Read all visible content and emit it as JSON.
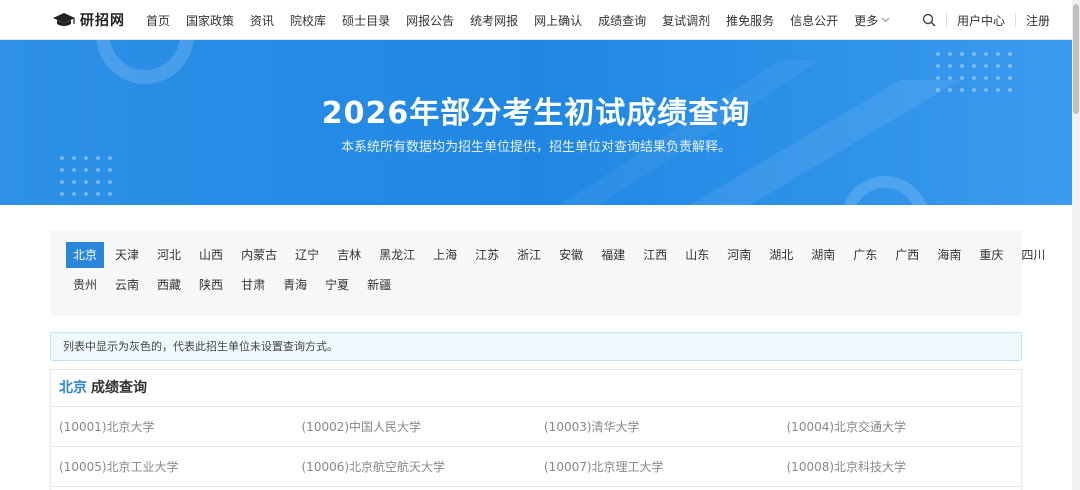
{
  "header": {
    "logo_text": "研招网",
    "nav": [
      "首页",
      "国家政策",
      "资讯",
      "院校库",
      "硕士目录",
      "网报公告",
      "统考网报",
      "网上确认",
      "成绩查询",
      "复试调剂",
      "推免服务",
      "信息公开"
    ],
    "more_label": "更多",
    "user_center": "用户中心",
    "register": "注册"
  },
  "banner": {
    "title": "2026年部分考生初试成绩查询",
    "subtitle": "本系统所有数据均为招生单位提供，招生单位对查询结果负责解释。"
  },
  "provinces": {
    "row1": [
      "北京",
      "天津",
      "河北",
      "山西",
      "内蒙古",
      "辽宁",
      "吉林",
      "黑龙江",
      "上海",
      "江苏",
      "浙江",
      "安徽",
      "福建",
      "江西",
      "山东",
      "河南",
      "湖北",
      "湖南",
      "广东",
      "广西",
      "海南",
      "重庆",
      "四川"
    ],
    "row2": [
      "贵州",
      "云南",
      "西藏",
      "陕西",
      "甘肃",
      "青海",
      "宁夏",
      "新疆"
    ],
    "selected": "北京"
  },
  "notice": "列表中显示为灰色的，代表此招生单位未设置查询方式。",
  "list": {
    "province": "北京",
    "title_suffix": "成绩查询",
    "rows": [
      [
        "(10001)北京大学",
        "(10002)中国人民大学",
        "(10003)清华大学",
        "(10004)北京交通大学"
      ],
      [
        "(10005)北京工业大学",
        "(10006)北京航空航天大学",
        "(10007)北京理工大学",
        "(10008)北京科技大学"
      ]
    ]
  },
  "colors": {
    "brand_blue": "#2a86d9",
    "banner_blue": "#2e90e8",
    "disabled_text": "#888888"
  }
}
